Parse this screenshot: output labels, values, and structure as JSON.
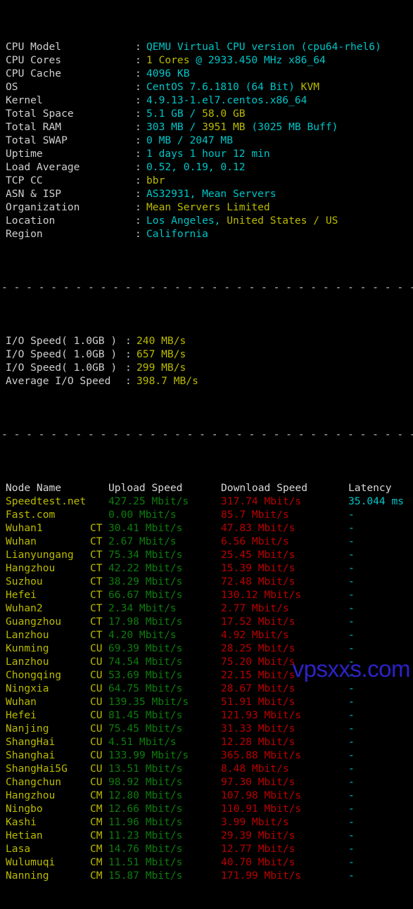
{
  "colors": {
    "background": "#000000",
    "label": "#d0d0d0",
    "cyan": "#00c5c7",
    "yellow": "#bbbb00",
    "green": "#0d7d0d",
    "red": "#bb0000",
    "watermark": "#2d22c8"
  },
  "system_info": [
    {
      "label": "CPU Model",
      "colon": ":",
      "value": "QEMU Virtual CPU version (cpu64-rhel6)",
      "color": "cyan"
    },
    {
      "label": "CPU Cores",
      "colon": ":",
      "value": "1 Cores @ 2933.450 MHz x86_64",
      "color": "mixed_cores"
    },
    {
      "label": "CPU Cache",
      "colon": ":",
      "value": "4096 KB",
      "color": "cyan"
    },
    {
      "label": "OS",
      "colon": ":",
      "value": "CentOS 7.6.1810 (64 Bit) KVM",
      "color": "mixed_os"
    },
    {
      "label": "Kernel",
      "colon": ":",
      "value": "4.9.13-1.el7.centos.x86_64",
      "color": "cyan"
    },
    {
      "label": "Total Space",
      "colon": ":",
      "value": "5.1 GB / 58.0 GB",
      "color": "mixed_space"
    },
    {
      "label": "Total RAM",
      "colon": ":",
      "value": "303 MB / 3951 MB (3025 MB Buff)",
      "color": "mixed_ram"
    },
    {
      "label": "Total SWAP",
      "colon": ":",
      "value": "0 MB / 2047 MB",
      "color": "cyan"
    },
    {
      "label": "Uptime",
      "colon": ":",
      "value": "1 days 1 hour 12 min",
      "color": "cyan"
    },
    {
      "label": "Load Average",
      "colon": ":",
      "value": "0.52, 0.19, 0.12",
      "color": "cyan"
    },
    {
      "label": "TCP CC",
      "colon": ":",
      "value": "bbr",
      "color": "yellow"
    },
    {
      "label": "ASN & ISP",
      "colon": ":",
      "value": "AS32931, Mean Servers",
      "color": "cyan"
    },
    {
      "label": "Organization",
      "colon": ":",
      "value": "Mean Servers Limited",
      "color": "yellow"
    },
    {
      "label": "Location",
      "colon": ":",
      "value": "Los Angeles, United States / US",
      "color": "mixed_location"
    },
    {
      "label": "Region",
      "colon": ":",
      "value": "California",
      "color": "cyan"
    }
  ],
  "system_info_parts": {
    "cores": [
      {
        "text": "1 Cores",
        "color": "yellow"
      },
      {
        "text": " @ 2933.450 MHz x86_64",
        "color": "cyan"
      }
    ],
    "os": [
      {
        "text": "CentOS 7.6.1810 (64 Bit) ",
        "color": "cyan"
      },
      {
        "text": "KVM",
        "color": "yellow"
      }
    ],
    "space": [
      {
        "text": "5.1 GB",
        "color": "cyan"
      },
      {
        "text": " / ",
        "color": "cyan"
      },
      {
        "text": "58.0 GB",
        "color": "yellow"
      }
    ],
    "ram": [
      {
        "text": "303 MB",
        "color": "cyan"
      },
      {
        "text": " / ",
        "color": "cyan"
      },
      {
        "text": "3951 MB",
        "color": "yellow"
      },
      {
        "text": " (3025 MB Buff)",
        "color": "cyan"
      }
    ],
    "location": [
      {
        "text": "Los Angeles, ",
        "color": "cyan"
      },
      {
        "text": "United States / US",
        "color": "yellow"
      }
    ]
  },
  "separator": "- - - - - - - - - - - - - - - - - - - - - - - - - - - - - - - - - - - - - - - - - - - - - - - - - -",
  "io_speed": [
    {
      "label": "I/O Speed( 1.0GB )",
      "colon": ":",
      "value": "240 MB/s"
    },
    {
      "label": "I/O Speed( 1.0GB )",
      "colon": ":",
      "value": "657 MB/s"
    },
    {
      "label": "I/O Speed( 1.0GB )",
      "colon": ":",
      "value": "299 MB/s"
    },
    {
      "label": "Average I/O Speed",
      "colon": ":",
      "value": "398.7 MB/s"
    }
  ],
  "speedtest": {
    "headers": {
      "node": "Node Name",
      "isp": "",
      "upload": "Upload Speed",
      "download": "Download Speed",
      "latency": "Latency"
    },
    "rows": [
      {
        "node": "Speedtest.net",
        "isp": "",
        "upload": "427.25 Mbit/s",
        "download": "317.74 Mbit/s",
        "latency": "35.044 ms"
      },
      {
        "node": "Fast.com",
        "isp": "",
        "upload": "0.00 Mbit/s",
        "download": "85.7 Mbit/s",
        "latency": "-"
      },
      {
        "node": "Wuhan1",
        "isp": "CT",
        "upload": "30.41 Mbit/s",
        "download": "47.83 Mbit/s",
        "latency": "-"
      },
      {
        "node": "Wuhan",
        "isp": "CT",
        "upload": "2.67 Mbit/s",
        "download": "6.56 Mbit/s",
        "latency": "-"
      },
      {
        "node": "Lianyungang",
        "isp": "CT",
        "upload": "75.34 Mbit/s",
        "download": "25.45 Mbit/s",
        "latency": "-"
      },
      {
        "node": "Hangzhou",
        "isp": "CT",
        "upload": "42.22 Mbit/s",
        "download": "15.39 Mbit/s",
        "latency": "-"
      },
      {
        "node": "Suzhou",
        "isp": "CT",
        "upload": "38.29 Mbit/s",
        "download": "72.48 Mbit/s",
        "latency": "-"
      },
      {
        "node": "Hefei",
        "isp": "CT",
        "upload": "66.67 Mbit/s",
        "download": "130.12 Mbit/s",
        "latency": "-"
      },
      {
        "node": "Wuhan2",
        "isp": "CT",
        "upload": "2.34 Mbit/s",
        "download": "2.77 Mbit/s",
        "latency": "-"
      },
      {
        "node": "Guangzhou",
        "isp": "CT",
        "upload": "17.98 Mbit/s",
        "download": "17.52 Mbit/s",
        "latency": "-"
      },
      {
        "node": "Lanzhou",
        "isp": "CT",
        "upload": "4.20 Mbit/s",
        "download": "4.92 Mbit/s",
        "latency": "-"
      },
      {
        "node": "Kunming",
        "isp": "CU",
        "upload": "69.39 Mbit/s",
        "download": "28.25 Mbit/s",
        "latency": "-"
      },
      {
        "node": "Lanzhou",
        "isp": "CU",
        "upload": "74.54 Mbit/s",
        "download": "75.20 Mbit/s",
        "latency": "-"
      },
      {
        "node": "Chongqing",
        "isp": "CU",
        "upload": "53.69 Mbit/s",
        "download": "22.15 Mbit/s",
        "latency": "-"
      },
      {
        "node": "Ningxia",
        "isp": "CU",
        "upload": "64.75 Mbit/s",
        "download": "28.67 Mbit/s",
        "latency": "-"
      },
      {
        "node": "Wuhan",
        "isp": "CU",
        "upload": "139.35 Mbit/s",
        "download": "51.91 Mbit/s",
        "latency": "-"
      },
      {
        "node": "Hefei",
        "isp": "CU",
        "upload": "81.45 Mbit/s",
        "download": "121.93 Mbit/s",
        "latency": "-"
      },
      {
        "node": "Nanjing",
        "isp": "CU",
        "upload": "75.45 Mbit/s",
        "download": "31.33 Mbit/s",
        "latency": "-"
      },
      {
        "node": "ShangHai",
        "isp": "CU",
        "upload": "4.51 Mbit/s",
        "download": "12.28 Mbit/s",
        "latency": "-"
      },
      {
        "node": "Shanghai",
        "isp": "CU",
        "upload": "133.99 Mbit/s",
        "download": "365.88 Mbit/s",
        "latency": "-"
      },
      {
        "node": "ShangHai5G",
        "isp": "CU",
        "upload": "13.51 Mbit/s",
        "download": "8.48 Mbit/s",
        "latency": "-"
      },
      {
        "node": "Changchun",
        "isp": "CU",
        "upload": "98.92 Mbit/s",
        "download": "97.30 Mbit/s",
        "latency": "-"
      },
      {
        "node": "Hangzhou",
        "isp": "CM",
        "upload": "12.80 Mbit/s",
        "download": "107.98 Mbit/s",
        "latency": "-"
      },
      {
        "node": "Ningbo",
        "isp": "CM",
        "upload": "12.66 Mbit/s",
        "download": "110.91 Mbit/s",
        "latency": "-"
      },
      {
        "node": "Kashi",
        "isp": "CM",
        "upload": "11.96 Mbit/s",
        "download": "3.99 Mbit/s",
        "latency": "-"
      },
      {
        "node": "Hetian",
        "isp": "CM",
        "upload": "11.23 Mbit/s",
        "download": "29.39 Mbit/s",
        "latency": "-"
      },
      {
        "node": "Lasa",
        "isp": "CM",
        "upload": "14.76 Mbit/s",
        "download": "12.77 Mbit/s",
        "latency": "-"
      },
      {
        "node": "Wulumuqi",
        "isp": "CM",
        "upload": "11.51 Mbit/s",
        "download": "40.70 Mbit/s",
        "latency": "-"
      },
      {
        "node": "Nanning",
        "isp": "CM",
        "upload": "15.87 Mbit/s",
        "download": "171.99 Mbit/s",
        "latency": "-"
      }
    ]
  },
  "watermark": "vpsxxs.com"
}
